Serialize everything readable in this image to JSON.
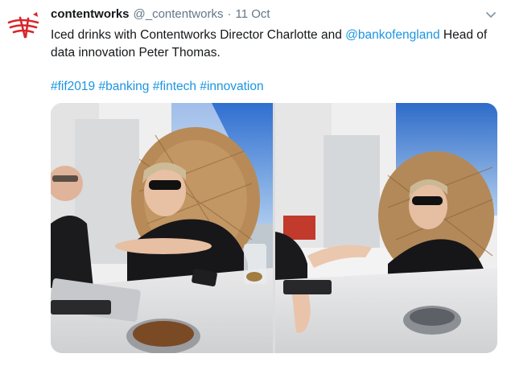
{
  "tweet": {
    "author_name": "contentworks",
    "author_handle": "@_contentworks",
    "separator": "·",
    "timestamp": "11 Oct",
    "text_part1": "Iced drinks with Contentworks Director Charlotte and ",
    "mention": "@bankofengland",
    "text_part2": " Head of data innovation Peter Thomas.",
    "hashtags": [
      "#fif2019",
      "#banking",
      "#fintech",
      "#innovation"
    ]
  },
  "icons": {
    "avatar": "contentworks-logo",
    "menu": "chevron-down-icon"
  },
  "colors": {
    "link": "#1b95e0",
    "secondary_text": "#657786",
    "brand_red": "#d7262b"
  },
  "media": {
    "photo_count": 2
  }
}
